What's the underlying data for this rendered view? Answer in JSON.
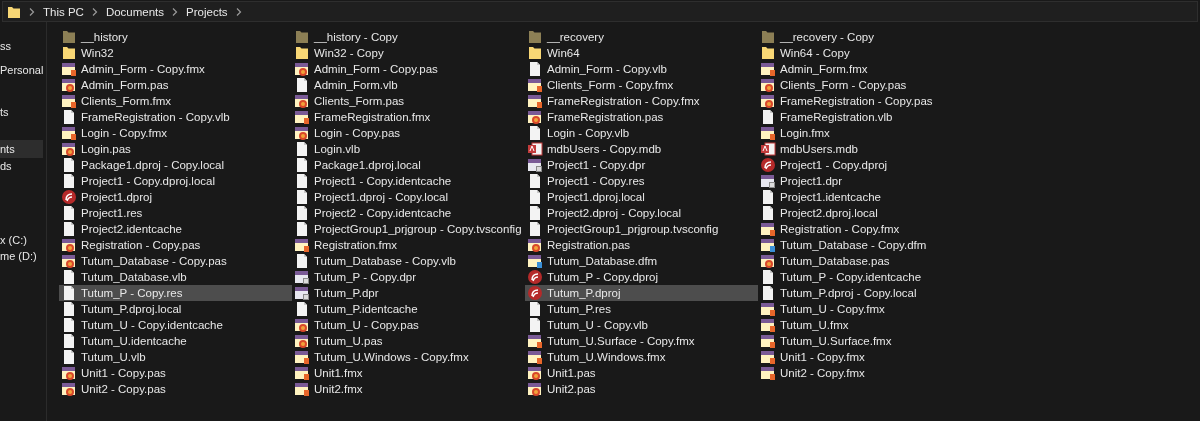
{
  "address_bar": {
    "segments": [
      "This PC",
      "Documents",
      "Projects"
    ]
  },
  "sidebar": {
    "items": [
      {
        "label": "ss",
        "selected": false
      },
      {
        "label": "Personal",
        "selected": false
      },
      {
        "label": "ts",
        "selected": false
      },
      {
        "label": "nts",
        "selected": true
      },
      {
        "label": "ds",
        "selected": false
      },
      {
        "label": "x (C:)",
        "selected": false
      },
      {
        "label": "me (D:)",
        "selected": false
      }
    ]
  },
  "file_list": {
    "columns": [
      [
        {
          "name": "__history",
          "kind": "folder-dim",
          "selected": false
        },
        {
          "name": "Win32",
          "kind": "folder",
          "selected": false
        },
        {
          "name": "Admin_Form - Copy.fmx",
          "kind": "fmx",
          "selected": false
        },
        {
          "name": "Admin_Form.pas",
          "kind": "pas",
          "selected": false
        },
        {
          "name": "Clients_Form.fmx",
          "kind": "fmx",
          "selected": false
        },
        {
          "name": "FrameRegistration - Copy.vlb",
          "kind": "file",
          "selected": false
        },
        {
          "name": "Login - Copy.fmx",
          "kind": "fmx",
          "selected": false
        },
        {
          "name": "Login.pas",
          "kind": "pas",
          "selected": false
        },
        {
          "name": "Package1.dproj - Copy.local",
          "kind": "file",
          "selected": false
        },
        {
          "name": "Project1 - Copy.dproj.local",
          "kind": "file",
          "selected": false
        },
        {
          "name": "Project1.dproj",
          "kind": "dproj",
          "selected": false
        },
        {
          "name": "Project1.res",
          "kind": "file",
          "selected": false
        },
        {
          "name": "Project2.identcache",
          "kind": "file",
          "selected": false
        },
        {
          "name": "Registration - Copy.pas",
          "kind": "pas",
          "selected": false
        },
        {
          "name": "Tutum_Database - Copy.pas",
          "kind": "pas",
          "selected": false
        },
        {
          "name": "Tutum_Database.vlb",
          "kind": "file",
          "selected": false
        },
        {
          "name": "Tutum_P - Copy.res",
          "kind": "file",
          "selected": true
        },
        {
          "name": "Tutum_P.dproj.local",
          "kind": "file",
          "selected": false
        },
        {
          "name": "Tutum_U - Copy.identcache",
          "kind": "file",
          "selected": false
        },
        {
          "name": "Tutum_U.identcache",
          "kind": "file",
          "selected": false
        },
        {
          "name": "Tutum_U.vlb",
          "kind": "file",
          "selected": false
        },
        {
          "name": "Unit1 - Copy.pas",
          "kind": "pas",
          "selected": false
        },
        {
          "name": "Unit2 - Copy.pas",
          "kind": "pas",
          "selected": false
        }
      ],
      [
        {
          "name": "__history - Copy",
          "kind": "folder-dim",
          "selected": false
        },
        {
          "name": "Win32 - Copy",
          "kind": "folder",
          "selected": false
        },
        {
          "name": "Admin_Form - Copy.pas",
          "kind": "pas",
          "selected": false
        },
        {
          "name": "Admin_Form.vlb",
          "kind": "file",
          "selected": false
        },
        {
          "name": "Clients_Form.pas",
          "kind": "pas",
          "selected": false
        },
        {
          "name": "FrameRegistration.fmx",
          "kind": "fmx",
          "selected": false
        },
        {
          "name": "Login - Copy.pas",
          "kind": "pas",
          "selected": false
        },
        {
          "name": "Login.vlb",
          "kind": "file",
          "selected": false
        },
        {
          "name": "Package1.dproj.local",
          "kind": "file",
          "selected": false
        },
        {
          "name": "Project1 - Copy.identcache",
          "kind": "file",
          "selected": false
        },
        {
          "name": "Project1.dproj - Copy.local",
          "kind": "file",
          "selected": false
        },
        {
          "name": "Project2 - Copy.identcache",
          "kind": "file",
          "selected": false
        },
        {
          "name": "ProjectGroup1_prjgroup - Copy.tvsconfig",
          "kind": "file",
          "selected": false
        },
        {
          "name": "Registration.fmx",
          "kind": "fmx",
          "selected": false
        },
        {
          "name": "Tutum_Database - Copy.vlb",
          "kind": "file",
          "selected": false
        },
        {
          "name": "Tutum_P - Copy.dpr",
          "kind": "dpr",
          "selected": false
        },
        {
          "name": "Tutum_P.dpr",
          "kind": "dpr",
          "selected": false
        },
        {
          "name": "Tutum_P.identcache",
          "kind": "file",
          "selected": false
        },
        {
          "name": "Tutum_U - Copy.pas",
          "kind": "pas",
          "selected": false
        },
        {
          "name": "Tutum_U.pas",
          "kind": "pas",
          "selected": false
        },
        {
          "name": "Tutum_U.Windows - Copy.fmx",
          "kind": "fmx",
          "selected": false
        },
        {
          "name": "Unit1.fmx",
          "kind": "fmx",
          "selected": false
        },
        {
          "name": "Unit2.fmx",
          "kind": "fmx",
          "selected": false
        }
      ],
      [
        {
          "name": "__recovery",
          "kind": "folder-dim",
          "selected": false
        },
        {
          "name": "Win64",
          "kind": "folder",
          "selected": false
        },
        {
          "name": "Admin_Form - Copy.vlb",
          "kind": "file",
          "selected": false
        },
        {
          "name": "Clients_Form - Copy.fmx",
          "kind": "fmx",
          "selected": false
        },
        {
          "name": "FrameRegistration - Copy.fmx",
          "kind": "fmx",
          "selected": false
        },
        {
          "name": "FrameRegistration.pas",
          "kind": "pas",
          "selected": false
        },
        {
          "name": "Login - Copy.vlb",
          "kind": "file",
          "selected": false
        },
        {
          "name": "mdbUsers - Copy.mdb",
          "kind": "mdb",
          "selected": false
        },
        {
          "name": "Project1 - Copy.dpr",
          "kind": "dpr",
          "selected": false
        },
        {
          "name": "Project1 - Copy.res",
          "kind": "file",
          "selected": false
        },
        {
          "name": "Project1.dproj.local",
          "kind": "file",
          "selected": false
        },
        {
          "name": "Project2.dproj - Copy.local",
          "kind": "file",
          "selected": false
        },
        {
          "name": "ProjectGroup1_prjgroup.tvsconfig",
          "kind": "file",
          "selected": false
        },
        {
          "name": "Registration.pas",
          "kind": "pas",
          "selected": false
        },
        {
          "name": "Tutum_Database.dfm",
          "kind": "dfm",
          "selected": false
        },
        {
          "name": "Tutum_P - Copy.dproj",
          "kind": "dproj",
          "selected": false
        },
        {
          "name": "Tutum_P.dproj",
          "kind": "dproj",
          "selected": true
        },
        {
          "name": "Tutum_P.res",
          "kind": "file",
          "selected": false
        },
        {
          "name": "Tutum_U - Copy.vlb",
          "kind": "file",
          "selected": false
        },
        {
          "name": "Tutum_U.Surface - Copy.fmx",
          "kind": "fmx",
          "selected": false
        },
        {
          "name": "Tutum_U.Windows.fmx",
          "kind": "fmx",
          "selected": false
        },
        {
          "name": "Unit1.pas",
          "kind": "pas",
          "selected": false
        },
        {
          "name": "Unit2.pas",
          "kind": "pas",
          "selected": false
        }
      ],
      [
        {
          "name": "__recovery - Copy",
          "kind": "folder-dim",
          "selected": false
        },
        {
          "name": "Win64 - Copy",
          "kind": "folder",
          "selected": false
        },
        {
          "name": "Admin_Form.fmx",
          "kind": "fmx",
          "selected": false
        },
        {
          "name": "Clients_Form - Copy.pas",
          "kind": "pas",
          "selected": false
        },
        {
          "name": "FrameRegistration - Copy.pas",
          "kind": "pas",
          "selected": false
        },
        {
          "name": "FrameRegistration.vlb",
          "kind": "file",
          "selected": false
        },
        {
          "name": "Login.fmx",
          "kind": "fmx",
          "selected": false
        },
        {
          "name": "mdbUsers.mdb",
          "kind": "mdb",
          "selected": false
        },
        {
          "name": "Project1 - Copy.dproj",
          "kind": "dproj",
          "selected": false
        },
        {
          "name": "Project1.dpr",
          "kind": "dpr",
          "selected": false
        },
        {
          "name": "Project1.identcache",
          "kind": "file",
          "selected": false
        },
        {
          "name": "Project2.dproj.local",
          "kind": "file",
          "selected": false
        },
        {
          "name": "Registration - Copy.fmx",
          "kind": "fmx",
          "selected": false
        },
        {
          "name": "Tutum_Database - Copy.dfm",
          "kind": "dfm",
          "selected": false
        },
        {
          "name": "Tutum_Database.pas",
          "kind": "pas",
          "selected": false
        },
        {
          "name": "Tutum_P - Copy.identcache",
          "kind": "file",
          "selected": false
        },
        {
          "name": "Tutum_P.dproj - Copy.local",
          "kind": "file",
          "selected": false
        },
        {
          "name": "Tutum_U - Copy.fmx",
          "kind": "fmx",
          "selected": false
        },
        {
          "name": "Tutum_U.fmx",
          "kind": "fmx",
          "selected": false
        },
        {
          "name": "Tutum_U.Surface.fmx",
          "kind": "fmx",
          "selected": false
        },
        {
          "name": "Unit1 - Copy.fmx",
          "kind": "fmx",
          "selected": false
        },
        {
          "name": "Unit2 - Copy.fmx",
          "kind": "fmx",
          "selected": false
        }
      ]
    ]
  }
}
